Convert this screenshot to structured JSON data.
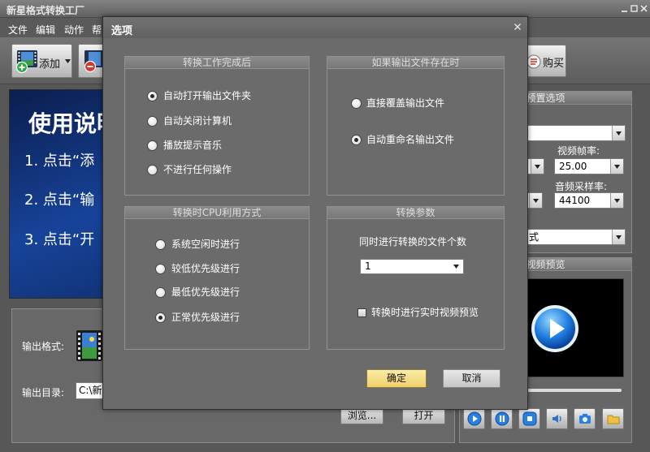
{
  "app": {
    "title": "新星格式转换工厂",
    "window_controls": [
      "minimize-icon",
      "maximize-icon",
      "close-icon"
    ]
  },
  "menu": {
    "items": [
      "文件",
      "编辑",
      "动作",
      "帮"
    ]
  },
  "toolbar": {
    "add_label": "添加",
    "buy_label": "购买"
  },
  "guide": {
    "heading": "使用说明",
    "steps": [
      "1. 点击“添",
      "2. 点击“输",
      "3. 点击“开"
    ]
  },
  "output": {
    "format_label": "输出格式:",
    "dir_label": "输出目录:",
    "dir_value": "C:\\新",
    "browse_label": "浏览...",
    "open_label": "打开"
  },
  "presets": {
    "header": "预置选项",
    "framerate_label": "视频帧率:",
    "framerate_value": "25.00",
    "samplerate_label": "音频采样率:",
    "samplerate_value": "44100",
    "format_value": "式"
  },
  "preview": {
    "header": "视频预览",
    "controls": [
      "play-icon",
      "pause-icon",
      "stop-icon",
      "volume-icon",
      "camera-icon",
      "folder-icon"
    ]
  },
  "dialog": {
    "title": "选项",
    "after_conversion": {
      "title": "转换工作完成后",
      "options": [
        {
          "label": "自动打开输出文件夹",
          "checked": true
        },
        {
          "label": "自动关闭计算机",
          "checked": false
        },
        {
          "label": "播放提示音乐",
          "checked": false
        },
        {
          "label": "不进行任何操作",
          "checked": false
        }
      ]
    },
    "if_output_exists": {
      "title": "如果输出文件存在时",
      "options": [
        {
          "label": "直接覆盖输出文件",
          "checked": false
        },
        {
          "label": "自动重命名输出文件",
          "checked": true
        }
      ]
    },
    "cpu_usage": {
      "title": "转换时CPU利用方式",
      "options": [
        {
          "label": "系统空闲时进行",
          "checked": false
        },
        {
          "label": "较低优先级进行",
          "checked": false
        },
        {
          "label": "最低优先级进行",
          "checked": false
        },
        {
          "label": "正常优先级进行",
          "checked": true
        }
      ]
    },
    "conversion_params": {
      "title": "转换参数",
      "concurrent_label": "同时进行转换的文件个数",
      "concurrent_value": "1",
      "realtime_preview_label": "转换时进行实时视频预览",
      "realtime_preview_checked": false
    },
    "ok_label": "确定",
    "cancel_label": "取消"
  },
  "colors": {
    "dialog_bg": "#6b6b6b",
    "ok_button": "#f0cf6a",
    "banner_blue": "#17439a"
  }
}
